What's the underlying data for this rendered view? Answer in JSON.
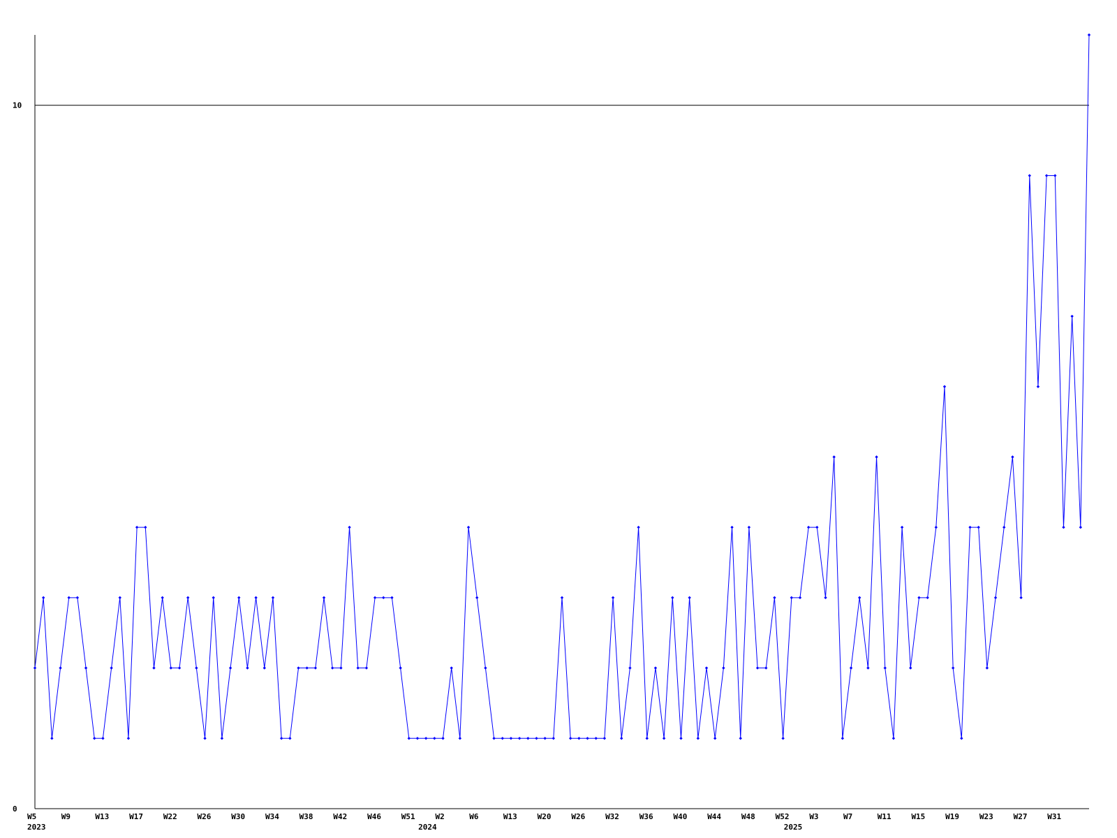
{
  "chart_data": {
    "type": "line",
    "title": "",
    "xlabel": "",
    "ylabel": "",
    "ylim": [
      0,
      11
    ],
    "y_ticks": [
      0,
      10
    ],
    "reference_line": 10,
    "grid": false,
    "line_color": "#0000ff",
    "marker_color": "#0000ff",
    "x_tick_labels": [
      {
        "index": 0,
        "label": "W5"
      },
      {
        "index": 4,
        "label": "W9"
      },
      {
        "index": 8,
        "label": "W13"
      },
      {
        "index": 12,
        "label": "W17"
      },
      {
        "index": 16,
        "label": "W22"
      },
      {
        "index": 20,
        "label": "W26"
      },
      {
        "index": 24,
        "label": "W30"
      },
      {
        "index": 28,
        "label": "W34"
      },
      {
        "index": 32,
        "label": "W38"
      },
      {
        "index": 36,
        "label": "W42"
      },
      {
        "index": 40,
        "label": "W46"
      },
      {
        "index": 44,
        "label": "W51"
      },
      {
        "index": 48,
        "label": "W2"
      },
      {
        "index": 52,
        "label": "W6"
      },
      {
        "index": 56,
        "label": "W13"
      },
      {
        "index": 60,
        "label": "W20"
      },
      {
        "index": 64,
        "label": "W26"
      },
      {
        "index": 68,
        "label": "W32"
      },
      {
        "index": 72,
        "label": "W36"
      },
      {
        "index": 76,
        "label": "W40"
      },
      {
        "index": 80,
        "label": "W44"
      },
      {
        "index": 84,
        "label": "W48"
      },
      {
        "index": 88,
        "label": "W52"
      },
      {
        "index": 92,
        "label": "W3"
      },
      {
        "index": 96,
        "label": "W7"
      },
      {
        "index": 100,
        "label": "W11"
      },
      {
        "index": 104,
        "label": "W15"
      },
      {
        "index": 108,
        "label": "W19"
      },
      {
        "index": 112,
        "label": "W23"
      },
      {
        "index": 116,
        "label": "W27"
      },
      {
        "index": 120,
        "label": "W31"
      }
    ],
    "year_labels": [
      {
        "index": 0,
        "label": "2023"
      },
      {
        "index": 46,
        "label": "2024"
      },
      {
        "index": 89,
        "label": "2025"
      }
    ],
    "series": [
      {
        "values": [
          2,
          3,
          1,
          2,
          3,
          3,
          2,
          1,
          1,
          2,
          3,
          1,
          4,
          4,
          2,
          3,
          2,
          2,
          3,
          2,
          1,
          3,
          1,
          2,
          3,
          2,
          3,
          2,
          3,
          1,
          1,
          2,
          2,
          2,
          3,
          2,
          2,
          4,
          2,
          2,
          3,
          3,
          3,
          2,
          1,
          1,
          1,
          1,
          1,
          2,
          1,
          4,
          3,
          2,
          1,
          1,
          1,
          1,
          1,
          1,
          1,
          1,
          3,
          1,
          1,
          1,
          1,
          1,
          3,
          1,
          2,
          4,
          1,
          2,
          1,
          3,
          1,
          3,
          1,
          2,
          1,
          2,
          4,
          1,
          4,
          2,
          2,
          3,
          1,
          3,
          3,
          4,
          4,
          3,
          5,
          1,
          2,
          3,
          2,
          5,
          2,
          1,
          4,
          2,
          3,
          3,
          4,
          6,
          2,
          1,
          4,
          4,
          2,
          3,
          4,
          5,
          3,
          9,
          6,
          9,
          9,
          4,
          7,
          4,
          11
        ]
      }
    ]
  }
}
